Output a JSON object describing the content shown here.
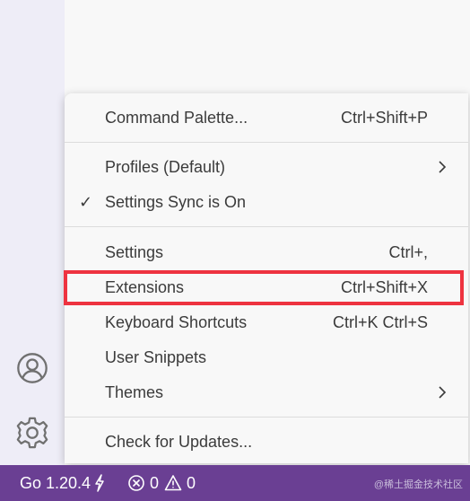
{
  "menu": {
    "items": [
      {
        "label": "Command Palette...",
        "shortcut": "Ctrl+Shift+P"
      },
      {
        "label": "Profiles (Default)",
        "submenu": true
      },
      {
        "label": "Settings Sync is On",
        "checked": true
      },
      {
        "label": "Settings",
        "shortcut": "Ctrl+,"
      },
      {
        "label": "Extensions",
        "shortcut": "Ctrl+Shift+X",
        "highlighted": true
      },
      {
        "label": "Keyboard Shortcuts",
        "shortcut": "Ctrl+K Ctrl+S"
      },
      {
        "label": "User Snippets"
      },
      {
        "label": "Themes",
        "submenu": true
      },
      {
        "label": "Check for Updates..."
      }
    ],
    "check_glyph": "✓"
  },
  "activity_bar": {
    "icons": [
      "account-icon",
      "manage-gear-icon"
    ]
  },
  "status_bar": {
    "go_version": "Go 1.20.4",
    "errors": "0",
    "warnings": "0"
  },
  "watermark": "@稀土掘金技术社区",
  "colors": {
    "status_bar": "#6a3f93",
    "highlight": "#ee3340",
    "activity_bar": "#eeedf7"
  }
}
